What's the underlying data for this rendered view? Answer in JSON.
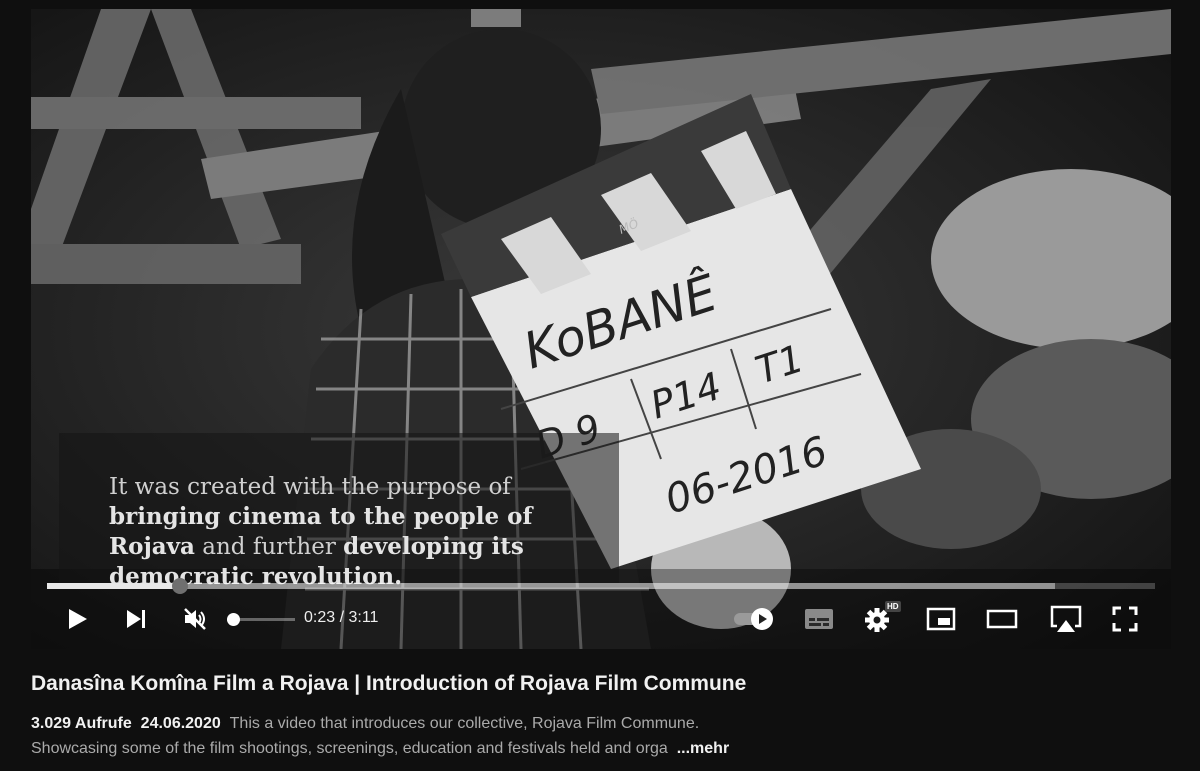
{
  "video": {
    "caption_parts": [
      "It was created with the purpose of",
      "bringing cinema to the people of",
      "Rojava",
      "and further",
      "developing its",
      "democratic revolution."
    ],
    "slate_text": [
      "KoBANÊ",
      "D 9",
      "P14",
      "T1",
      "06-2016",
      "MÖ"
    ],
    "progress": {
      "played_fraction": 0.12,
      "buffered_fraction": 0.91
    },
    "volume_level": 0
  },
  "controls": {
    "time_current": "0:23",
    "time_separator": " / ",
    "time_total": "3:11",
    "hd_badge": "HD",
    "icons": [
      "play-icon",
      "next-icon",
      "volume-muted-icon",
      "autoplay-toggle-icon",
      "subtitles-icon",
      "settings-icon",
      "miniplayer-icon",
      "theater-mode-icon",
      "airplay-icon",
      "fullscreen-icon"
    ]
  },
  "info": {
    "title": "Danasîna Komîna Film a Rojava | Introduction of Rojava Film Commune",
    "views": "3.029 Aufrufe",
    "date": "24.06.2020",
    "description_line1": "This a video that introduces our collective, Rojava Film Commune.",
    "description_line2": "Showcasing some of the film shootings, screenings, education and festivals held and orga",
    "more_label": "...mehr"
  },
  "colors": {
    "background": "#0f0f0f",
    "text": "#f1f1f1",
    "secondary_text": "#aaaaaa"
  }
}
